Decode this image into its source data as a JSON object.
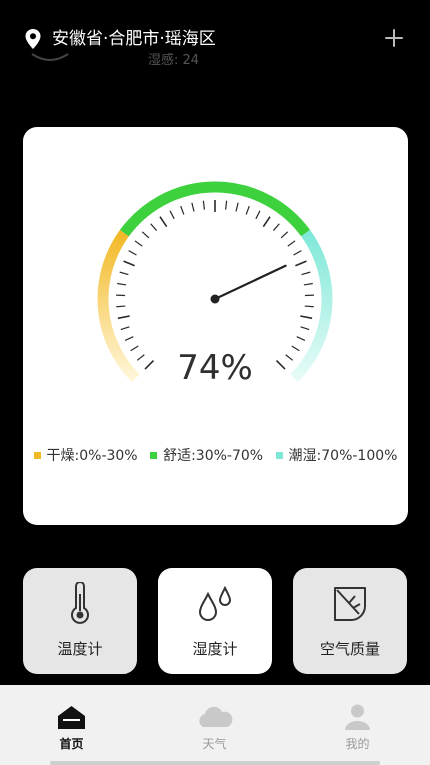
{
  "header": {
    "location": "安徽省·合肥市·瑶海区",
    "peek_text": "湿感: 24"
  },
  "gauge": {
    "value_percent": 74,
    "value_label": "74%",
    "colors": {
      "dry": "#f2b926",
      "comfort": "#3ed13e",
      "humid": "#7fe8d8"
    }
  },
  "legend": {
    "dry": "干燥:0%-30%",
    "comfort": "舒适:30%-70%",
    "humid": "潮湿:70%-100%"
  },
  "tiles": [
    {
      "label": "温度计",
      "icon": "thermometer-icon"
    },
    {
      "label": "湿度计",
      "icon": "water-drops-icon"
    },
    {
      "label": "空气质量",
      "icon": "leaf-icon"
    }
  ],
  "tabs": [
    {
      "label": "首页",
      "icon": "home-icon"
    },
    {
      "label": "天气",
      "icon": "cloud-icon"
    },
    {
      "label": "我的",
      "icon": "user-icon"
    }
  ]
}
